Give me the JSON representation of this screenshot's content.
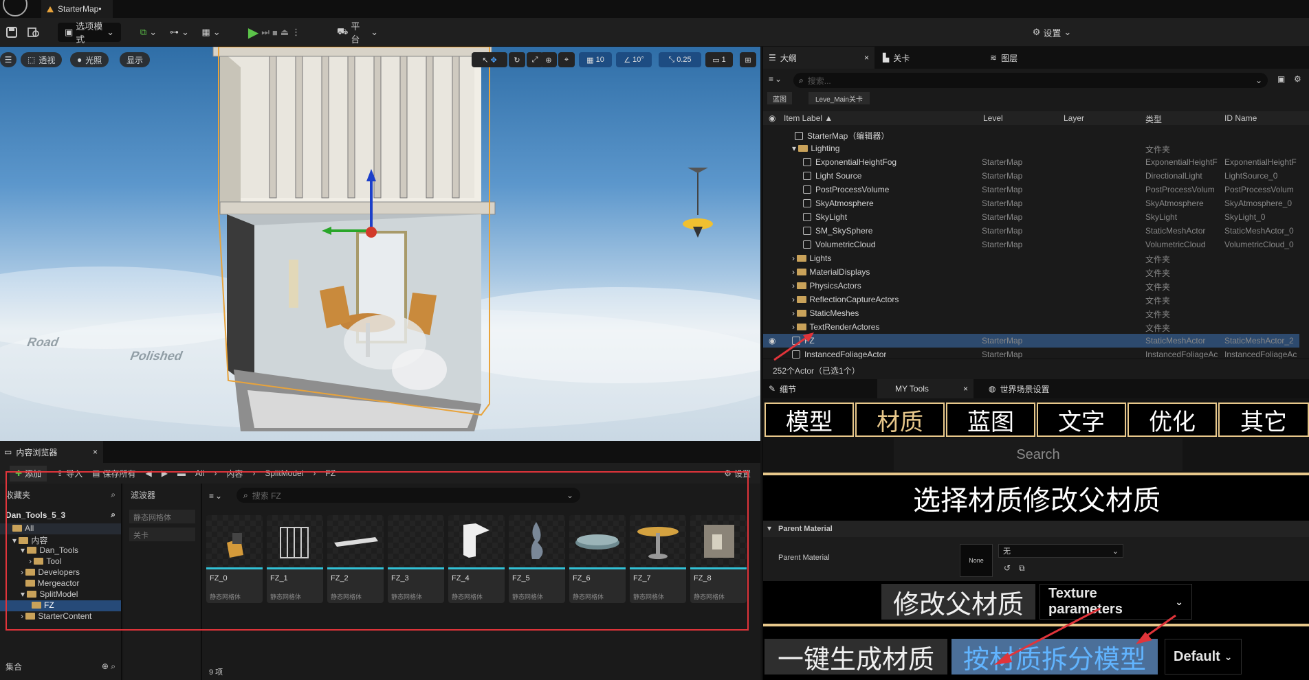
{
  "window": {
    "tab_title": "StarterMap•"
  },
  "toolbar": {
    "mode_label": "选项模式",
    "platform_label": "平台",
    "settings_label": "设置"
  },
  "viewport": {
    "perspective": "透视",
    "lighting": "光照",
    "show": "显示",
    "grid_snap": "10",
    "rot_snap": "10°",
    "scale_snap": "0.25",
    "camera_speed": "1",
    "floor_texts": [
      "Road",
      "Polished"
    ]
  },
  "content_browser": {
    "tab_title": "内容浏览器",
    "add": "添加",
    "import": "导入",
    "save_all": "保存所有",
    "breadcrumb": [
      "All",
      "内容",
      "SplitModel",
      "FZ"
    ],
    "settings": "设置",
    "favorites": "收藏夹",
    "project": "Dan_Tools_5_3",
    "tree": [
      "All",
      "内容",
      "Dan_Tools",
      "Tool",
      "Developers",
      "Mergeactor",
      "SplitModel",
      "FZ",
      "StarterContent"
    ],
    "collections": "集合",
    "filters_title": "滤波器",
    "filters": [
      "静态网格体",
      "关卡"
    ],
    "search_placeholder": "搜索 FZ",
    "assets": [
      {
        "name": "FZ_0",
        "type": "静态网格体"
      },
      {
        "name": "FZ_1",
        "type": "静态网格体"
      },
      {
        "name": "FZ_2",
        "type": "静态网格体"
      },
      {
        "name": "FZ_3",
        "type": "静态网格体"
      },
      {
        "name": "FZ_4",
        "type": "静态网格体"
      },
      {
        "name": "FZ_5",
        "type": "静态网格体"
      },
      {
        "name": "FZ_6",
        "type": "静态网格体"
      },
      {
        "name": "FZ_7",
        "type": "静态网格体"
      },
      {
        "name": "FZ_8",
        "type": "静态网格体"
      }
    ],
    "item_count": "9 项"
  },
  "outliner": {
    "tabs": [
      "大纲",
      "关卡",
      "图层"
    ],
    "search_placeholder": "搜索...",
    "chips": [
      "蓝图",
      "Leve_Main关卡"
    ],
    "columns": [
      "Item Label ▲",
      "Level",
      "Layer",
      "类型",
      "ID Name"
    ],
    "root": "StarterMap（编辑器）",
    "rows": [
      {
        "label": "Lighting",
        "kind": "folder",
        "level": "",
        "type": "文件夹",
        "id": ""
      },
      {
        "label": "ExponentialHeightFog",
        "kind": "actor",
        "level": "StarterMap",
        "type": "ExponentialHeightF",
        "id": "ExponentialHeightF"
      },
      {
        "label": "Light Source",
        "kind": "actor",
        "level": "StarterMap",
        "type": "DirectionalLight",
        "id": "LightSource_0"
      },
      {
        "label": "PostProcessVolume",
        "kind": "actor",
        "level": "StarterMap",
        "type": "PostProcessVolum",
        "id": "PostProcessVolum"
      },
      {
        "label": "SkyAtmosphere",
        "kind": "actor",
        "level": "StarterMap",
        "type": "SkyAtmosphere",
        "id": "SkyAtmosphere_0"
      },
      {
        "label": "SkyLight",
        "kind": "actor",
        "level": "StarterMap",
        "type": "SkyLight",
        "id": "SkyLight_0"
      },
      {
        "label": "SM_SkySphere",
        "kind": "actor",
        "level": "StarterMap",
        "type": "StaticMeshActor",
        "id": "StaticMeshActor_0"
      },
      {
        "label": "VolumetricCloud",
        "kind": "actor",
        "level": "StarterMap",
        "type": "VolumetricCloud",
        "id": "VolumetricCloud_0"
      },
      {
        "label": "Lights",
        "kind": "folder",
        "level": "",
        "type": "文件夹",
        "id": ""
      },
      {
        "label": "MaterialDisplays",
        "kind": "folder",
        "level": "",
        "type": "文件夹",
        "id": ""
      },
      {
        "label": "PhysicsActors",
        "kind": "folder",
        "level": "",
        "type": "文件夹",
        "id": ""
      },
      {
        "label": "ReflectionCaptureActors",
        "kind": "folder",
        "level": "",
        "type": "文件夹",
        "id": ""
      },
      {
        "label": "StaticMeshes",
        "kind": "folder",
        "level": "",
        "type": "文件夹",
        "id": ""
      },
      {
        "label": "TextRenderActores",
        "kind": "folder",
        "level": "",
        "type": "文件夹",
        "id": ""
      },
      {
        "label": "FZ",
        "kind": "actor",
        "level": "StarterMap",
        "type": "StaticMeshActor",
        "id": "StaticMeshActor_2",
        "selected": true
      },
      {
        "label": "InstancedFoliageActor",
        "kind": "actor",
        "level": "StarterMap",
        "type": "InstancedFoliageAc",
        "id": "InstancedFoliageAc"
      }
    ],
    "status": "252个Actor（已选1个）"
  },
  "details": {
    "tabs": [
      "细节",
      "MY Tools",
      "世界场景设置"
    ],
    "categories": [
      "模型",
      "材质",
      "蓝图",
      "文字",
      "优化",
      "其它"
    ],
    "search": "Search",
    "heading": "选择材质修改父材质",
    "section": "Parent Material",
    "prop_label": "Parent Material",
    "thumb_label": "None",
    "combo_value": "无",
    "modify_btn": "修改父材质",
    "texture_dd": "Texture parameters",
    "gen_btn": "一键生成材质",
    "split_btn": "按材质拆分模型",
    "default_dd": "Default"
  }
}
